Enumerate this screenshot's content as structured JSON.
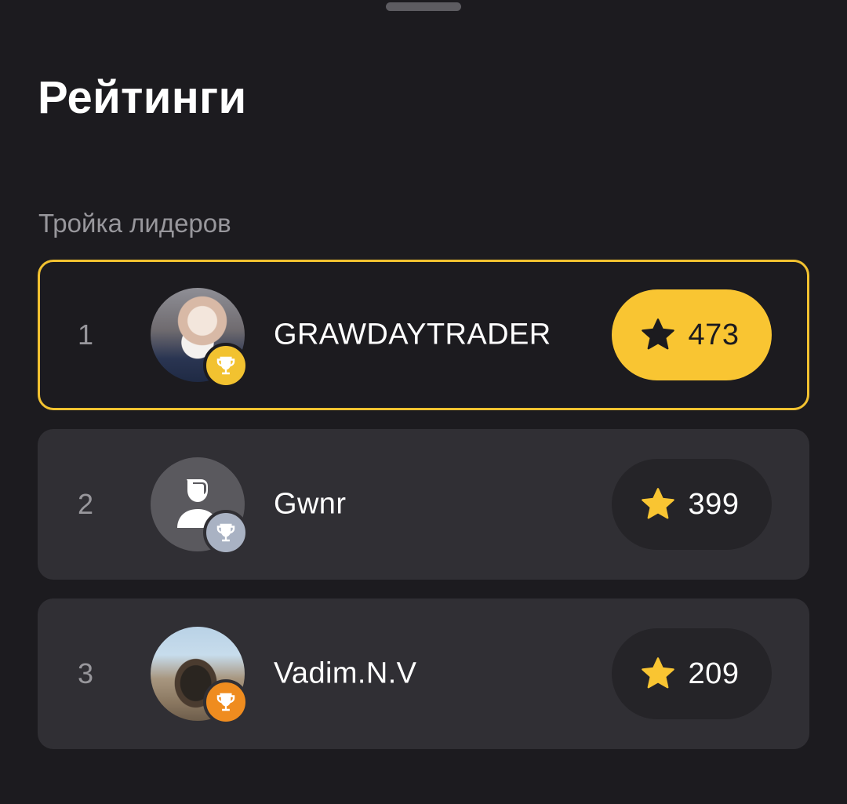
{
  "header": {
    "title": "Рейтинги"
  },
  "section": {
    "label": "Тройка лидеров"
  },
  "leaders": [
    {
      "rank": "1",
      "name": "GRAWDAYTRADER",
      "score": "473",
      "avatar": "user-photo",
      "trophy": "gold-trophy-icon"
    },
    {
      "rank": "2",
      "name": "Gwnr",
      "score": "399",
      "avatar": "default-person-icon",
      "trophy": "silver-trophy-icon"
    },
    {
      "rank": "3",
      "name": "Vadim.N.V",
      "score": "209",
      "avatar": "user-photo",
      "trophy": "bronze-trophy-icon"
    }
  ],
  "colors": {
    "background": "#1c1b1f",
    "card": "#302f34",
    "accent_gold": "#f9c532",
    "silver": "#a9b2c3",
    "bronze": "#ef8c1f",
    "muted_text": "#98979c"
  }
}
